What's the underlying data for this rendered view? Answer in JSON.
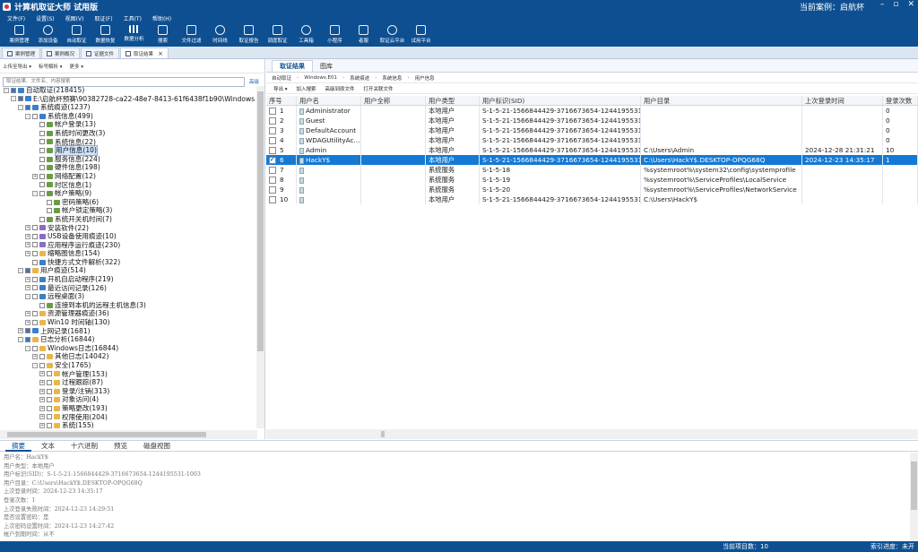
{
  "app": {
    "title": "计算机取证大师 试用版",
    "current_case": "当前案例：启航杯",
    "win_min": "–",
    "win_max": "▫",
    "win_close": "✕"
  },
  "menu": [
    "文件(F)",
    "设置(S)",
    "视图(V)",
    "取证(F)",
    "工具(T)",
    "帮助(H)"
  ],
  "toolbar": [
    {
      "label": "案例管理",
      "icon": "case-icon"
    },
    {
      "label": "添加设备",
      "icon": "add-device-icon"
    },
    {
      "label": "自动取证",
      "icon": "auto-forensics-icon"
    },
    {
      "label": "数据恢复",
      "icon": "data-recovery-icon"
    },
    {
      "label": "数据分析",
      "icon": "data-analysis-icon"
    },
    {
      "label": "搜索",
      "icon": "search-icon"
    },
    {
      "label": "文件过滤",
      "icon": "file-filter-icon"
    },
    {
      "label": "时间线",
      "icon": "timeline-icon"
    },
    {
      "label": "取证报告",
      "icon": "report-icon"
    },
    {
      "label": "调度取证",
      "icon": "schedule-icon"
    },
    {
      "label": "工具箱",
      "icon": "toolbox-icon"
    },
    {
      "label": "小程序",
      "icon": "mini-program-icon"
    },
    {
      "label": "者服",
      "icon": "service-icon"
    },
    {
      "label": "取证云平台",
      "icon": "cloud-icon"
    },
    {
      "label": "试用平台",
      "icon": "trial-platform-icon"
    }
  ],
  "doc_tabs": [
    "案例管理",
    "案例概况",
    "证据文件",
    "取证结果"
  ],
  "left": {
    "tools": [
      "上传至导出 ▾",
      "标号解析 ▾",
      "更多 ▾"
    ],
    "search_placeholder": "取证结果、文件名、内容搜索",
    "search_btn": "高级",
    "tree": [
      {
        "d": 0,
        "e": "-",
        "t": "自动取证(218415)",
        "f": "b"
      },
      {
        "d": 1,
        "e": "-",
        "t": "E:\\启航杯预赛\\90382728-ca22-48e7-8413-61f6438f1b90\\Windows.E01(21",
        "f": "b"
      },
      {
        "d": 2,
        "e": "-",
        "t": "系统痕迹(1237)",
        "f": "b"
      },
      {
        "d": 3,
        "e": "-",
        "t": "系统信息(499)",
        "f": "b"
      },
      {
        "d": 4,
        "e": "",
        "t": "帐户登录(13)",
        "f": "g"
      },
      {
        "d": 4,
        "e": "",
        "t": "系统时间更改(3)",
        "f": "g"
      },
      {
        "d": 4,
        "e": "",
        "t": "系统信息(22)",
        "f": "g"
      },
      {
        "d": 4,
        "e": "",
        "t": "用户信息(10)",
        "f": "g",
        "hl": true
      },
      {
        "d": 4,
        "e": "",
        "t": "服务信息(224)",
        "f": "g"
      },
      {
        "d": 4,
        "e": "",
        "t": "硬件信息(198)",
        "f": "g"
      },
      {
        "d": 4,
        "e": "+",
        "t": "网络配置(12)",
        "f": "g"
      },
      {
        "d": 4,
        "e": "",
        "t": "时区信息(1)",
        "f": "g"
      },
      {
        "d": 4,
        "e": "-",
        "t": "帐户策略(9)",
        "f": "g"
      },
      {
        "d": 5,
        "e": "",
        "t": "密码策略(6)",
        "f": "g"
      },
      {
        "d": 5,
        "e": "",
        "t": "帐户锁定策略(3)",
        "f": "g"
      },
      {
        "d": 4,
        "e": "",
        "t": "系统开关机时间(7)",
        "f": "g"
      },
      {
        "d": 3,
        "e": "+",
        "t": "安装软件(22)",
        "f": "p"
      },
      {
        "d": 3,
        "e": "+",
        "t": "USB设备使用痕迹(10)",
        "f": "p"
      },
      {
        "d": 3,
        "e": "+",
        "t": "应用程序运行痕迹(230)",
        "f": "p"
      },
      {
        "d": 3,
        "e": "+",
        "t": "缩略图信息(154)",
        "f": ""
      },
      {
        "d": 3,
        "e": "",
        "t": "快捷方式文件解析(322)",
        "f": "b"
      },
      {
        "d": 2,
        "e": "-",
        "t": "用户痕迹(514)",
        "f": ""
      },
      {
        "d": 3,
        "e": "+",
        "t": "开机自启动程序(219)",
        "f": "b"
      },
      {
        "d": 3,
        "e": "+",
        "t": "最近访问记录(126)",
        "f": "b"
      },
      {
        "d": 3,
        "e": "-",
        "t": "远程桌面(3)",
        "f": "b"
      },
      {
        "d": 4,
        "e": "",
        "t": "连接到本机的远程主机信息(3)",
        "f": "g"
      },
      {
        "d": 3,
        "e": "+",
        "t": "资源管理器痕迹(36)",
        "f": ""
      },
      {
        "d": 3,
        "e": "+",
        "t": "Win10 时间轴(130)",
        "f": ""
      },
      {
        "d": 2,
        "e": "+",
        "t": "上网记录(1681)",
        "f": "b"
      },
      {
        "d": 2,
        "e": "-",
        "t": "日志分析(16844)",
        "f": ""
      },
      {
        "d": 3,
        "e": "-",
        "t": "Windows日志(16844)",
        "f": ""
      },
      {
        "d": 4,
        "e": "+",
        "t": "其他日志(14042)",
        "f": ""
      },
      {
        "d": 4,
        "e": "-",
        "t": "安全(1765)",
        "f": ""
      },
      {
        "d": 5,
        "e": "+",
        "t": "帐户管理(153)",
        "f": ""
      },
      {
        "d": 5,
        "e": "+",
        "t": "过程跟踪(87)",
        "f": ""
      },
      {
        "d": 5,
        "e": "+",
        "t": "登录/注销(313)",
        "f": ""
      },
      {
        "d": 5,
        "e": "+",
        "t": "对象访问(4)",
        "f": ""
      },
      {
        "d": 5,
        "e": "+",
        "t": "策略更改(193)",
        "f": ""
      },
      {
        "d": 5,
        "e": "+",
        "t": "权限使用(204)",
        "f": ""
      },
      {
        "d": 5,
        "e": "+",
        "t": "系统(155)",
        "f": ""
      }
    ]
  },
  "right": {
    "tabs": [
      "取证结果",
      "图库"
    ],
    "path": [
      "自动取证",
      "Windows.E01",
      "系统痕迹",
      "系统信息",
      "用户信息"
    ],
    "tools": [
      "导出 ▾",
      "加入搜索",
      "高级到原文件",
      "打开关联文件"
    ],
    "columns": [
      "序号",
      "用户名",
      "用户全称",
      "用户类型",
      "用户标识(SID)",
      "用户目录",
      "上次登录时间",
      "登录次数"
    ],
    "rows": [
      {
        "n": "1",
        "name": "Administrator",
        "full": "",
        "type": "本地用户",
        "sid": "S-1-5-21-1566844429-3716673654-1244195531-500",
        "dir": "",
        "last": "",
        "count": "0",
        "sel": false
      },
      {
        "n": "2",
        "name": "Guest",
        "full": "",
        "type": "本地用户",
        "sid": "S-1-5-21-1566844429-3716673654-1244195531-501",
        "dir": "",
        "last": "",
        "count": "0",
        "sel": false
      },
      {
        "n": "3",
        "name": "DefaultAccount",
        "full": "",
        "type": "本地用户",
        "sid": "S-1-5-21-1566844429-3716673654-1244195531-503",
        "dir": "",
        "last": "",
        "count": "0",
        "sel": false
      },
      {
        "n": "4",
        "name": "WDAGUtilityAc...",
        "full": "",
        "type": "本地用户",
        "sid": "S-1-5-21-1566844429-3716673654-1244195531-504",
        "dir": "",
        "last": "",
        "count": "0",
        "sel": false
      },
      {
        "n": "5",
        "name": "Admin",
        "full": "",
        "type": "本地用户",
        "sid": "S-1-5-21-1566844429-3716673654-1244195531-1001",
        "dir": "C:\\Users\\Admin",
        "last": "2024-12-28 21:31:21",
        "count": "10",
        "sel": false
      },
      {
        "n": "6",
        "name": "HackY$",
        "full": "",
        "type": "本地用户",
        "sid": "S-1-5-21-1566844429-3716673654-1244195531-1003",
        "dir": "C:\\Users\\HackY$.DESKTOP-OPQG68Q",
        "last": "2024-12-23 14:35:17",
        "count": "1",
        "sel": true
      },
      {
        "n": "7",
        "name": "",
        "full": "",
        "type": "系统服务",
        "sid": "S-1-5-18",
        "dir": "%systemroot%\\system32\\config\\systemprofile",
        "last": "",
        "count": "",
        "sel": false
      },
      {
        "n": "8",
        "name": "",
        "full": "",
        "type": "系统服务",
        "sid": "S-1-5-19",
        "dir": "%systemroot%\\ServiceProfiles\\LocalService",
        "last": "",
        "count": "",
        "sel": false
      },
      {
        "n": "9",
        "name": "",
        "full": "",
        "type": "系统服务",
        "sid": "S-1-5-20",
        "dir": "%systemroot%\\ServiceProfiles\\NetworkService",
        "last": "",
        "count": "",
        "sel": false
      },
      {
        "n": "10",
        "name": "",
        "full": "",
        "type": "本地用户",
        "sid": "S-1-5-21-1566844429-3716673654-1244195531-1003",
        "dir": "C:\\Users\\HackY$",
        "last": "",
        "count": "",
        "sel": false
      }
    ]
  },
  "bottom": {
    "tabs": [
      "摘要",
      "文本",
      "十六进制",
      "预览",
      "磁盘视图"
    ],
    "lines": [
      "用户名：HackY$",
      "用户类型：本地用户",
      "用户标识(SID)：S-1-5-21-1566844429-3716673654-1244195531-1003",
      "用户目录：C:\\Users\\HackY$.DESKTOP-OPQG68Q",
      "上次登录时间：2024-12-23 14:35:17",
      "登录次数：1",
      "上次登录失败时间：2024-12-23 14:29:51",
      "是否设置密码：是",
      "上次密码设置时间：2024-12-23 14:27:42",
      "帐户到期时间：从不",
      "帐户禁用：否"
    ]
  },
  "status": {
    "count": "当前项目数：10",
    "progress": "索引进度：未开"
  }
}
